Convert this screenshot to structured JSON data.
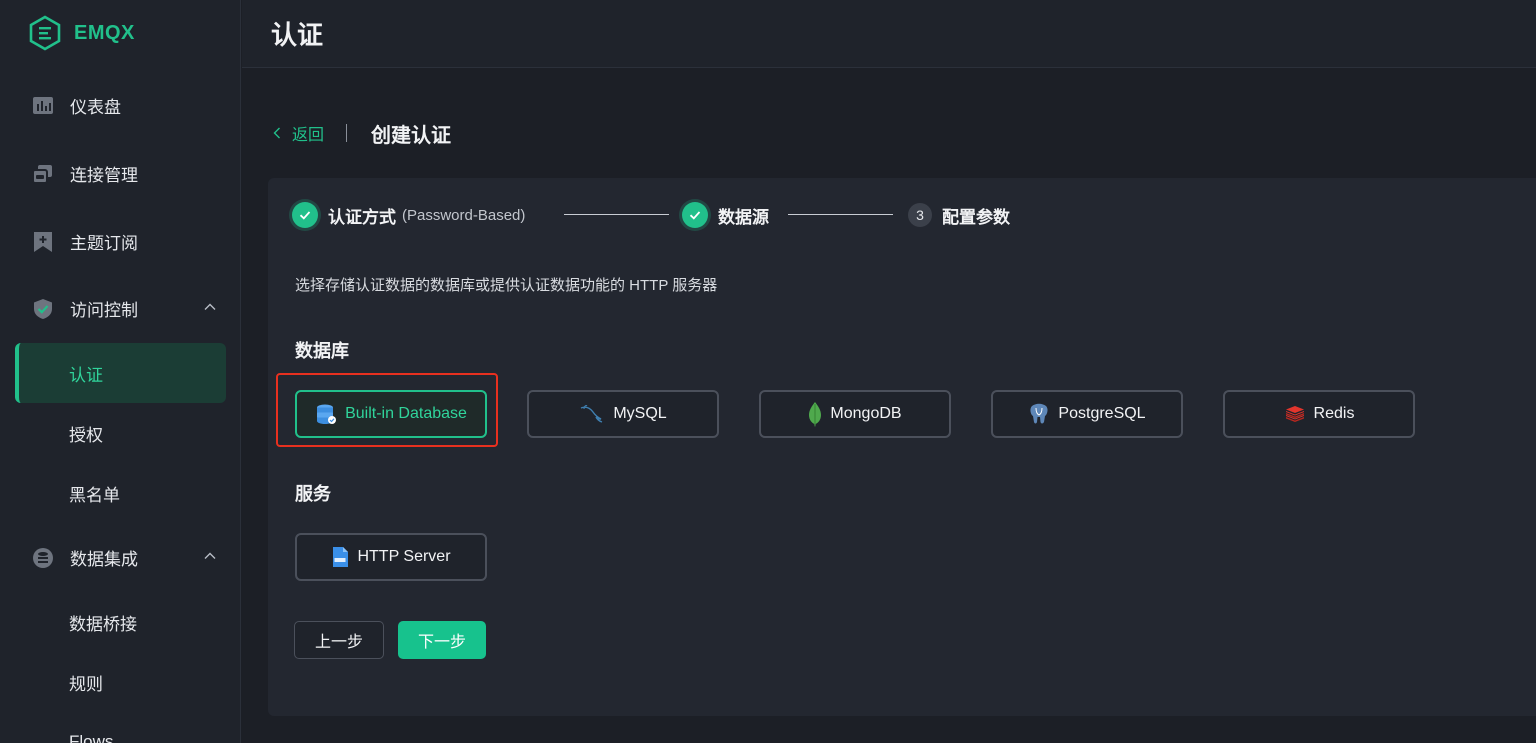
{
  "app": {
    "logo_text": "EMQX",
    "accent": "#21c08b"
  },
  "sidebar": {
    "items": [
      {
        "label": "仪表盘",
        "icon": "dashboard-icon"
      },
      {
        "label": "连接管理",
        "icon": "connections-icon"
      },
      {
        "label": "主题订阅",
        "icon": "topic-subscribe-icon"
      },
      {
        "label": "访问控制",
        "icon": "shield-icon"
      },
      {
        "label": "数据集成",
        "icon": "data-integration-icon"
      }
    ],
    "access_control_sub": [
      {
        "label": "认证",
        "active": true
      },
      {
        "label": "授权"
      },
      {
        "label": "黑名单"
      }
    ],
    "data_integration_sub": [
      {
        "label": "数据桥接"
      },
      {
        "label": "规则"
      },
      {
        "label": "Flows"
      }
    ]
  },
  "header": {
    "title": "认证"
  },
  "breadcrumb": {
    "back_label": "返回",
    "page_title": "创建认证"
  },
  "steps": [
    {
      "label": "认证方式",
      "sub": "(Password-Based)",
      "status": "done"
    },
    {
      "label": "数据源",
      "status": "done"
    },
    {
      "number": "3",
      "label": "配置参数",
      "status": "pending"
    }
  ],
  "description": "选择存储认证数据的数据库或提供认证数据功能的 HTTP 服务器",
  "database_section": {
    "title": "数据库",
    "options": [
      {
        "label": "Built-in Database",
        "icon": "database-icon",
        "selected": true
      },
      {
        "label": "MySQL",
        "icon": "mysql-icon"
      },
      {
        "label": "MongoDB",
        "icon": "mongodb-icon"
      },
      {
        "label": "PostgreSQL",
        "icon": "postgresql-icon"
      },
      {
        "label": "Redis",
        "icon": "redis-icon"
      }
    ]
  },
  "service_section": {
    "title": "服务",
    "options": [
      {
        "label": "HTTP Server",
        "icon": "http-file-icon"
      }
    ]
  },
  "actions": {
    "prev_label": "上一步",
    "next_label": "下一步"
  }
}
